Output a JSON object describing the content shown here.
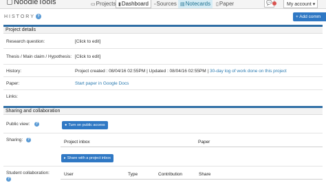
{
  "app": {
    "logo": "NoodleTools"
  },
  "nav": {
    "projects": "Projects",
    "dashboard": "Dashboard",
    "sources": "Sources",
    "notecards": "Notecards",
    "paper": "Paper",
    "account": "My account ▾"
  },
  "history": {
    "label": "HISTORY",
    "help": "?",
    "add_button": "+ Add comm"
  },
  "project_details": {
    "title": "Project details",
    "research_question_label": "Research question:",
    "research_question_value": "[Click to edit]",
    "thesis_label": "Thesis / Main claim / Hypothesis:",
    "thesis_value": "[Click to edit]",
    "history_label": "History:",
    "history_value": "Project created : 08/04/16 02:55PM | Updated : 08/04/16 02:55PM |",
    "history_link": "30-day log of work done on this project",
    "paper_label": "Paper:",
    "paper_link": "Start paper in Google Docs",
    "links_label": "Links:"
  },
  "sharing": {
    "title": "Sharing and collaboration",
    "public_view_label": "Public view:",
    "public_access_button": "Turn on public access",
    "sharing_label": "Sharing:",
    "project_inbox_header": "Project inbox",
    "paper_header": "Paper",
    "share_inbox_button": "Share with a project inbox",
    "student_collab_label": "Student collaboration:",
    "user_header": "User",
    "type_header": "Type",
    "contribution_header": "Contribution",
    "share_header": "Share",
    "help": "?"
  },
  "colors": {
    "accent": "#2f78c4",
    "section_bar": "#2e6da4",
    "notecards_tab_bg": "#d5ecf5",
    "link": "#2a7ab0"
  }
}
